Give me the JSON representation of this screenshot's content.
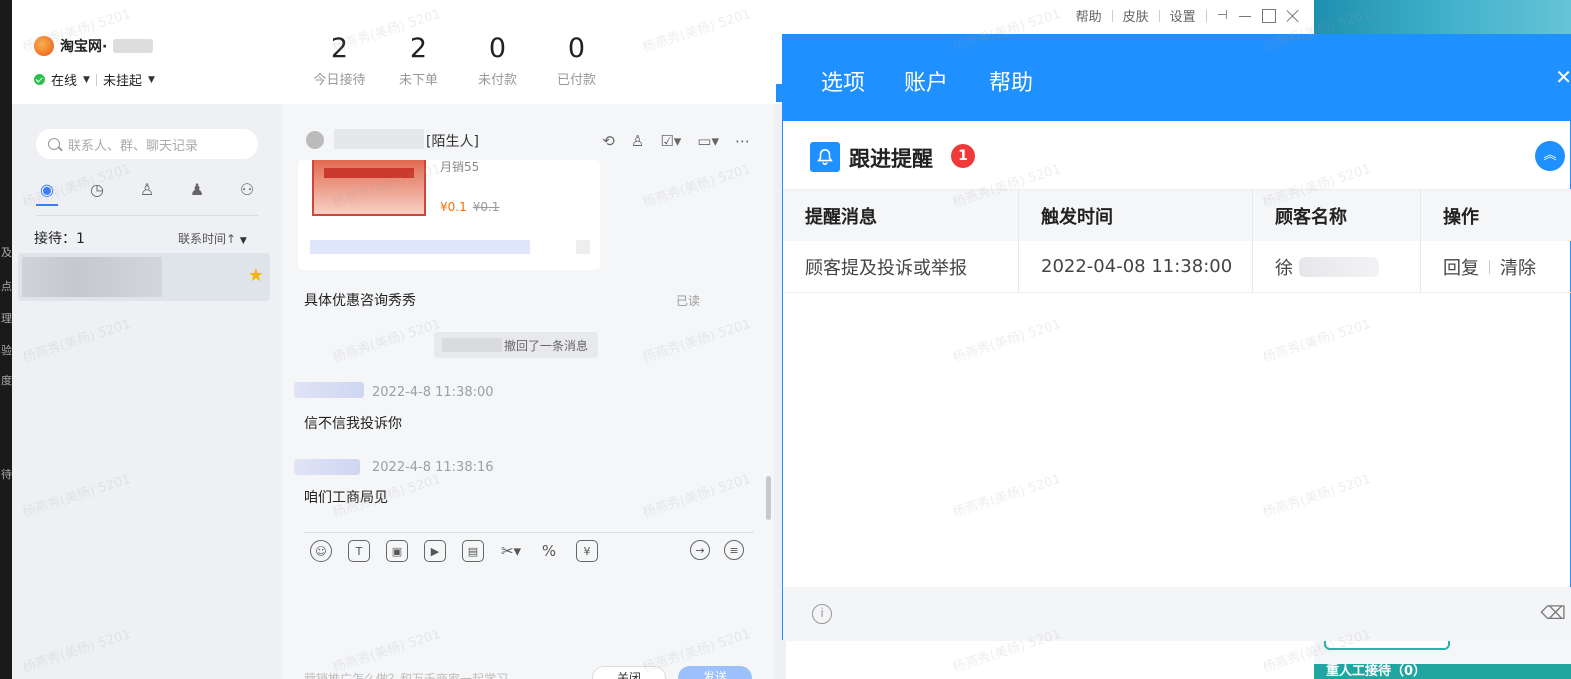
{
  "left_strip": {
    "chars": [
      "及",
      "点",
      "理",
      "验",
      "度",
      "待"
    ]
  },
  "header": {
    "shop_name": "淘宝网·",
    "status": "在线",
    "hang": "未挂起",
    "stats": [
      {
        "value": "2",
        "label": "今日接待"
      },
      {
        "value": "2",
        "label": "未下单"
      },
      {
        "value": "0",
        "label": "未付款"
      },
      {
        "value": "0",
        "label": "已付款"
      }
    ],
    "window_controls": {
      "help": "帮助",
      "skin": "皮肤",
      "settings": "设置"
    }
  },
  "sidebar": {
    "search_placeholder": "联系人、群、聊天记录",
    "receiving": "接待：1",
    "sort": "联系时间↑"
  },
  "chat": {
    "title": "[陌生人]",
    "card": {
      "subtitle": "月销55",
      "price": "¥0.1",
      "old_price": "¥0.1"
    },
    "promo_message": "具体优惠咨询秀秀",
    "read_status": "已读",
    "recall_notice": "撤回了一条消息",
    "messages": [
      {
        "time": "2022-4-8 11:38:00",
        "text": "信不信我投诉你"
      },
      {
        "time": "2022-4-8 11:38:16",
        "text": "咱们工商局见"
      }
    ],
    "input_hint": "营销推广怎么做？和万千商家一起学习",
    "close_label": "关闭",
    "send_label": "发送"
  },
  "popup": {
    "menu": [
      "选项",
      "账户",
      "帮助"
    ],
    "title": "跟进提醒",
    "badge": "1",
    "table": {
      "headers": [
        "提醒消息",
        "触发时间",
        "顾客名称",
        "操作"
      ],
      "rows": [
        {
          "message": "顾客提及投诉或举报",
          "time": "2022-04-08 11:38:00",
          "customer": "徐",
          "actions": [
            "回复",
            "清除"
          ]
        }
      ]
    }
  },
  "background_window": {
    "footer": "重人工接待（0）"
  },
  "watermark": "杨燕秀(美杨) 5201",
  "colors": {
    "accent": "#1e90ff",
    "badge": "#f03a3a",
    "online": "#2dbf4f",
    "price": "#ff6a00"
  }
}
